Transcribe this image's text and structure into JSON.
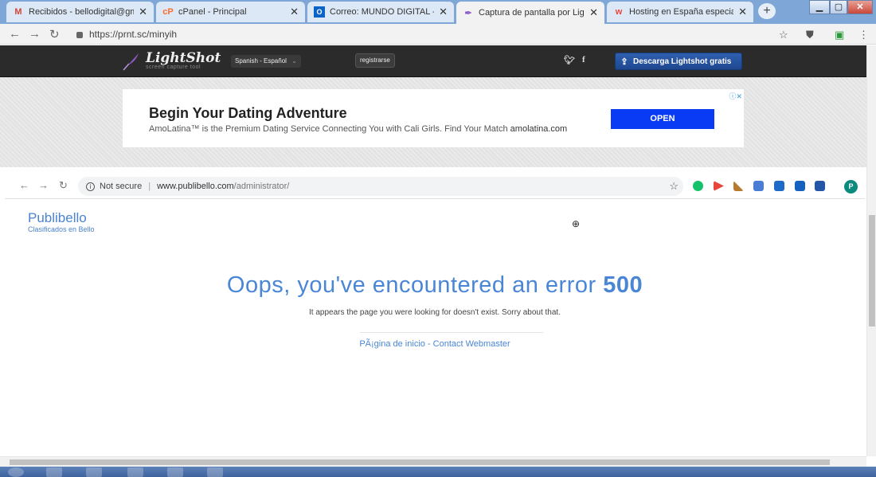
{
  "browser": {
    "tabs": [
      {
        "icon": "gmail-icon",
        "favicon": "M",
        "title": "Recibidos - bellodigital@gmail.c"
      },
      {
        "icon": "cpanel-icon",
        "favicon": "cP",
        "title": "cPanel - Principal"
      },
      {
        "icon": "outlook-icon",
        "favicon": "O",
        "title": "Correo: MUNDO DIGITAL - Outl"
      },
      {
        "icon": "lightshot-icon",
        "favicon": "✒",
        "title": "Captura de pantalla por Lightsh"
      },
      {
        "icon": "webempresa-icon",
        "favicon": "w",
        "title": "Hosting en España especializad"
      }
    ],
    "url": "https://prnt.sc/minyih"
  },
  "lightshot": {
    "logo": "LightShot",
    "tagline": "screen capture tool",
    "language": "Spanish - Español",
    "register": "registrarse",
    "download": "Descarga Lightshot gratis",
    "colors": {
      "header": "#2b2b2b",
      "download_button": "#1f4790"
    }
  },
  "ad": {
    "title": "Begin Your Dating Adventure",
    "text": "AmoLatina™ is the Premium Dating Service Connecting You with Cali Girls. Find Your Match",
    "domain": "amolatina.com",
    "button": "OPEN",
    "button_color": "#0a3bf4"
  },
  "screenshot": {
    "security": "Not secure",
    "url_host": "www.publibello.com",
    "url_path": "/administrator/",
    "profile_initial": "P",
    "site_name": "Publibello",
    "site_tagline": "Clasificados en Bello",
    "error_title": "Oops, you've encountered an error",
    "error_code": "500",
    "error_message": "It appears the page you were looking for doesn't exist. Sorry about that.",
    "links": "PÃ¡gina de inicio - Contact Webmaster",
    "accent_color": "#4a86d6"
  }
}
